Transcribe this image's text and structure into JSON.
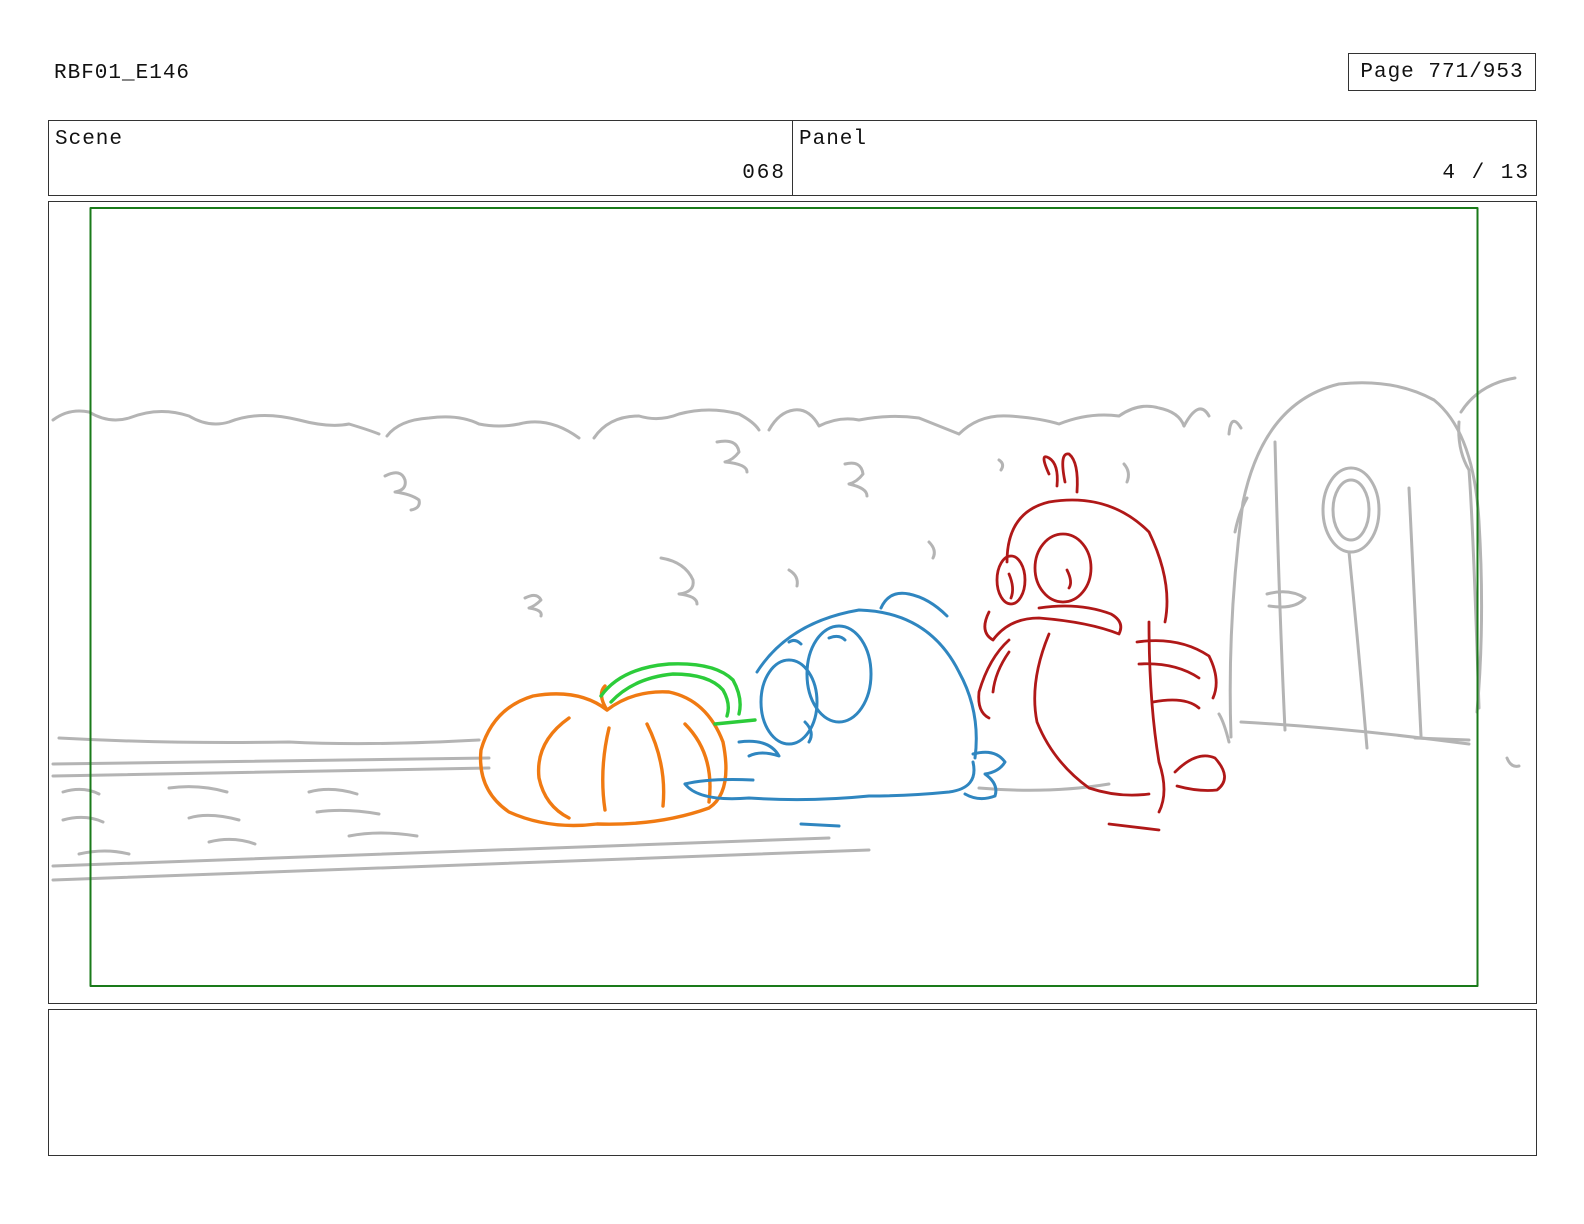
{
  "header": {
    "production_code": "RBF01_E146",
    "page_label": "Page 771/953"
  },
  "info": {
    "scene_label": "Scene",
    "scene_value": "068",
    "panel_label": "Panel",
    "panel_value": "4 / 13"
  },
  "drawing": {
    "icon": "storyboard-sketch",
    "colors": {
      "safe_frame": "#1a7a1a",
      "background_lines": "#b4b4b4",
      "pumpkin": "#f07a12",
      "stem": "#2ccc3a",
      "blue_character": "#2f86c0",
      "red_character": "#b01818"
    }
  },
  "notes": {
    "text": ""
  }
}
